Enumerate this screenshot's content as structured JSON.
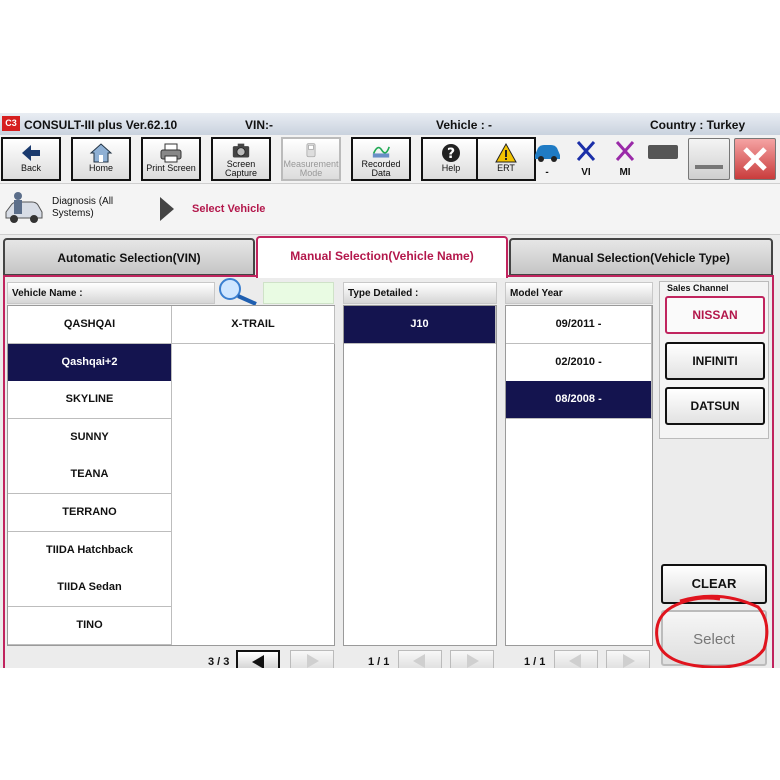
{
  "title_bar": {
    "logo": "C3",
    "app_name": "CONSULT-III plus  Ver.62.10",
    "vin": "VIN:-",
    "vehicle": "Vehicle : -",
    "country": "Country : Turkey"
  },
  "toolbar": {
    "back": "Back",
    "home": "Home",
    "print": "Print Screen",
    "capture_1": "Screen",
    "capture_2": "Capture",
    "measure_1": "Measurement",
    "measure_2": "Mode",
    "recorded_1": "Recorded",
    "recorded_2": "Data",
    "help": "Help",
    "ert": "ERT",
    "vehicle_status": "-",
    "vi": "VI",
    "mi": "MI"
  },
  "breadcrumb": {
    "diagnosis": "Diagnosis (All Systems)",
    "current": "Select Vehicle"
  },
  "tabs": {
    "automatic": "Automatic Selection(VIN)",
    "manual_name": "Manual Selection(Vehicle Name)",
    "manual_type": "Manual Selection(Vehicle Type)"
  },
  "vehicle_name": {
    "header": "Vehicle Name :",
    "col1": [
      "QASHQAI",
      "Qashqai+2",
      "SKYLINE",
      "SUNNY",
      "TEANA",
      "TERRANO",
      "TIIDA Hatchback",
      "TIIDA Sedan",
      "TINO"
    ],
    "col2": [
      "X-TRAIL"
    ],
    "selected": "Qashqai+2",
    "pager": "3 / 3"
  },
  "type_detailed": {
    "header": "Type Detailed :",
    "items": [
      "J10"
    ],
    "pager": "1 / 1"
  },
  "model_year": {
    "header": "Model Year",
    "items": [
      "09/2011 -",
      "02/2010 -",
      "08/2008 -"
    ],
    "selected": "08/2008 -",
    "pager": "1 / 1"
  },
  "sales_channel": {
    "header": "Sales Channel",
    "nissan": "NISSAN",
    "infiniti": "INFINITI",
    "datsun": "DATSUN"
  },
  "actions": {
    "clear": "CLEAR",
    "select": "Select"
  },
  "colors": {
    "selection": "#14144f",
    "accent": "#c0245e",
    "annotation": "#e0141e"
  }
}
